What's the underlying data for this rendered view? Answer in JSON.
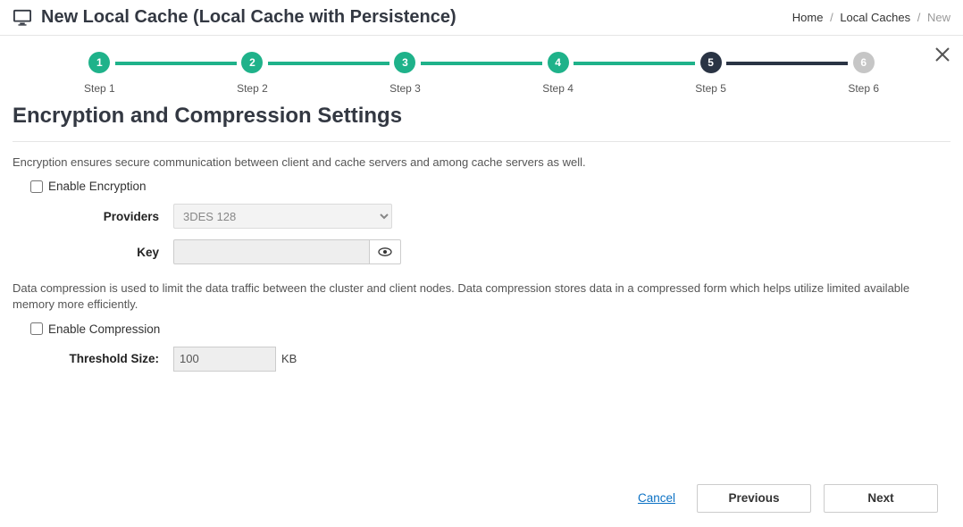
{
  "header": {
    "title": "New Local Cache (Local Cache with Persistence)"
  },
  "breadcrumb": {
    "home": "Home",
    "caches": "Local Caches",
    "current": "New"
  },
  "stepper": {
    "steps": [
      {
        "num": "1",
        "label": "Step 1",
        "color": "green"
      },
      {
        "num": "2",
        "label": "Step 2",
        "color": "green"
      },
      {
        "num": "3",
        "label": "Step 3",
        "color": "green"
      },
      {
        "num": "4",
        "label": "Step 4",
        "color": "green"
      },
      {
        "num": "5",
        "label": "Step 5",
        "color": "dark"
      },
      {
        "num": "6",
        "label": "Step 6",
        "color": "gray"
      }
    ],
    "connectors": [
      "green",
      "green",
      "green",
      "green",
      "dark",
      "gray"
    ]
  },
  "section": {
    "title": "Encryption and Compression Settings"
  },
  "encryption": {
    "desc": "Encryption ensures secure communication between client and cache servers and among cache servers as well.",
    "enable_label": "Enable Encryption",
    "providers_label": "Providers",
    "providers_value": "3DES 128",
    "key_label": "Key",
    "key_value": ""
  },
  "compression": {
    "desc": "Data compression is used to limit the data traffic between the cluster and client nodes. Data compression stores data in a compressed form which helps utilize limited available memory more efficiently.",
    "enable_label": "Enable Compression",
    "threshold_label": "Threshold Size:",
    "threshold_value": "100",
    "threshold_unit": "KB"
  },
  "footer": {
    "cancel": "Cancel",
    "previous": "Previous",
    "next": "Next"
  }
}
